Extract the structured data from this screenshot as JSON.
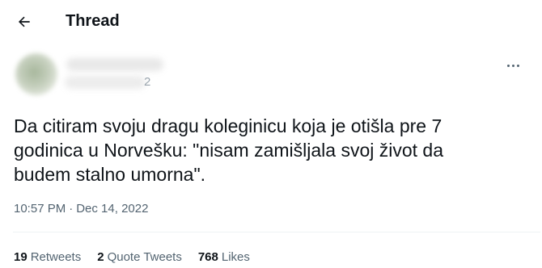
{
  "header": {
    "title": "Thread",
    "back_icon": "arrow-left-icon"
  },
  "author": {
    "handle_suffix": "2",
    "avatar": "blurred-avatar",
    "more_icon": "more-horizontal-icon"
  },
  "tweet": {
    "text": "Da citiram svoju dragu koleginicu koja je otišla pre 7\ngodinica u Norvešku: \"nisam zamišljala svoj život da\nbudem stalno umorna\".",
    "time": "10:57 PM",
    "separator": "·",
    "date": "Dec 14, 2022"
  },
  "stats": {
    "retweets_count": "19",
    "retweets_label": "Retweets",
    "quotes_count": "2",
    "quotes_label": "Quote Tweets",
    "likes_count": "768",
    "likes_label": "Likes"
  },
  "colors": {
    "text_primary": "#0f1419",
    "text_secondary": "#536471",
    "divider": "#eff3f4"
  }
}
